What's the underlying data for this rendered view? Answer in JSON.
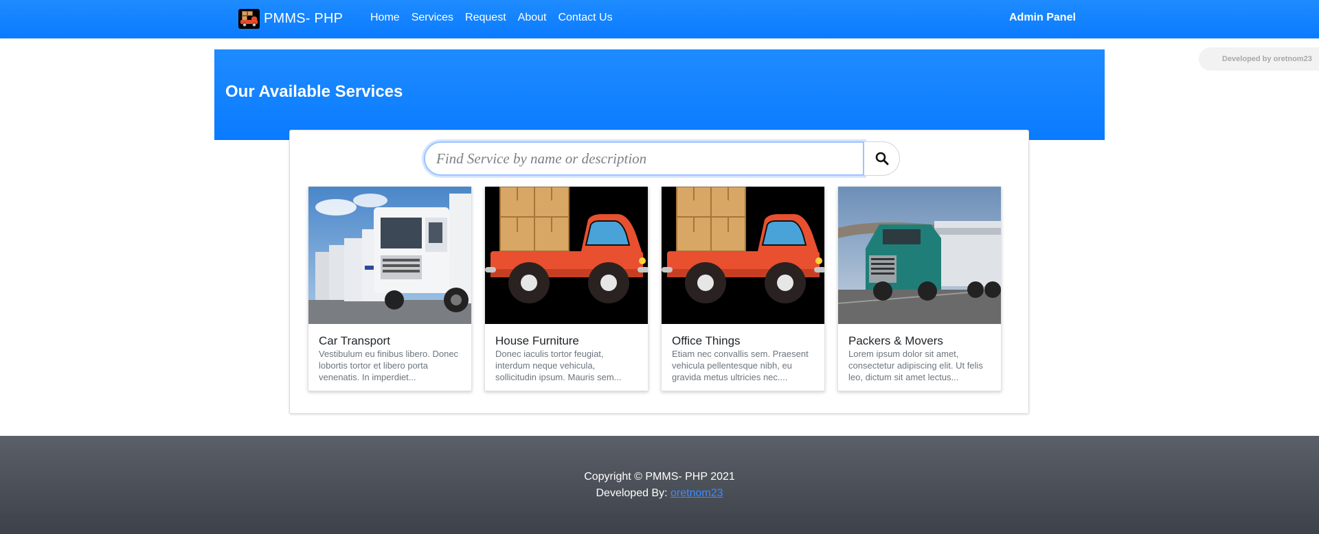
{
  "navbar": {
    "brand": "PMMS- PHP",
    "links": [
      "Home",
      "Services",
      "Request",
      "About",
      "Contact Us"
    ],
    "admin": "Admin Panel"
  },
  "dev_tag": "Developed by oretnom23",
  "banner": {
    "title": "Our Available Services"
  },
  "search": {
    "placeholder": "Find Service by name or description",
    "icon": "search-icon"
  },
  "services": [
    {
      "title": "Car Transport",
      "description": "Vestibulum eu finibus libero. Donec lobortis tortor et libero porta venenatis. In imperdiet...",
      "image": "truck-fleet-photo"
    },
    {
      "title": "House Furniture",
      "description": "Donec iaculis tortor feugiat, interdum neque vehicula, sollicitudin ipsum. Mauris sem...",
      "image": "cartoon-truck-boxes"
    },
    {
      "title": "Office Things",
      "description": "Etiam nec convallis sem. Praesent vehicula pellentesque nibh, eu gravida metus ultricies nec....",
      "image": "cartoon-truck-boxes"
    },
    {
      "title": "Packers & Movers",
      "description": "Lorem ipsum dolor sit amet, consectetur adipiscing elit. Ut felis leo, dictum sit amet lectus...",
      "image": "green-semi-truck-photo"
    }
  ],
  "footer": {
    "copyright": "Copyright © PMMS- PHP 2021",
    "developed_label": "Developed By:",
    "developer": "oretnom23"
  },
  "colors": {
    "primary": "#0d7bff",
    "footer": "#4a4e55"
  }
}
